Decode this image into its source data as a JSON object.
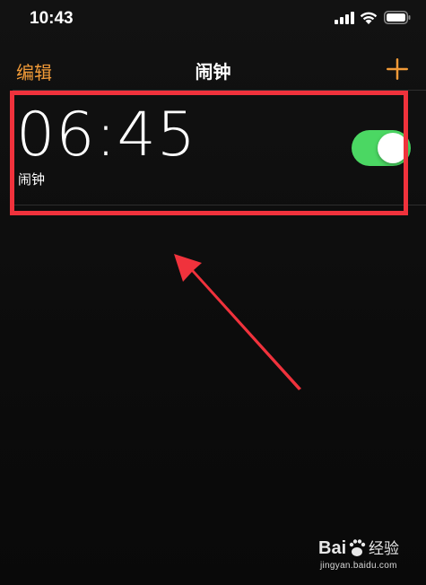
{
  "status_bar": {
    "time": "10:43"
  },
  "nav": {
    "edit_label": "编辑",
    "title": "闹钟",
    "add_icon": "plus-icon"
  },
  "alarm": {
    "time": "06:45",
    "label": "闹钟",
    "enabled": true
  },
  "colors": {
    "accent": "#f19a38",
    "toggle_on": "#4bd763",
    "annotation": "#f0323c"
  },
  "watermark": {
    "brand": "Bai 经验",
    "url": "jingyan.baidu.com"
  }
}
